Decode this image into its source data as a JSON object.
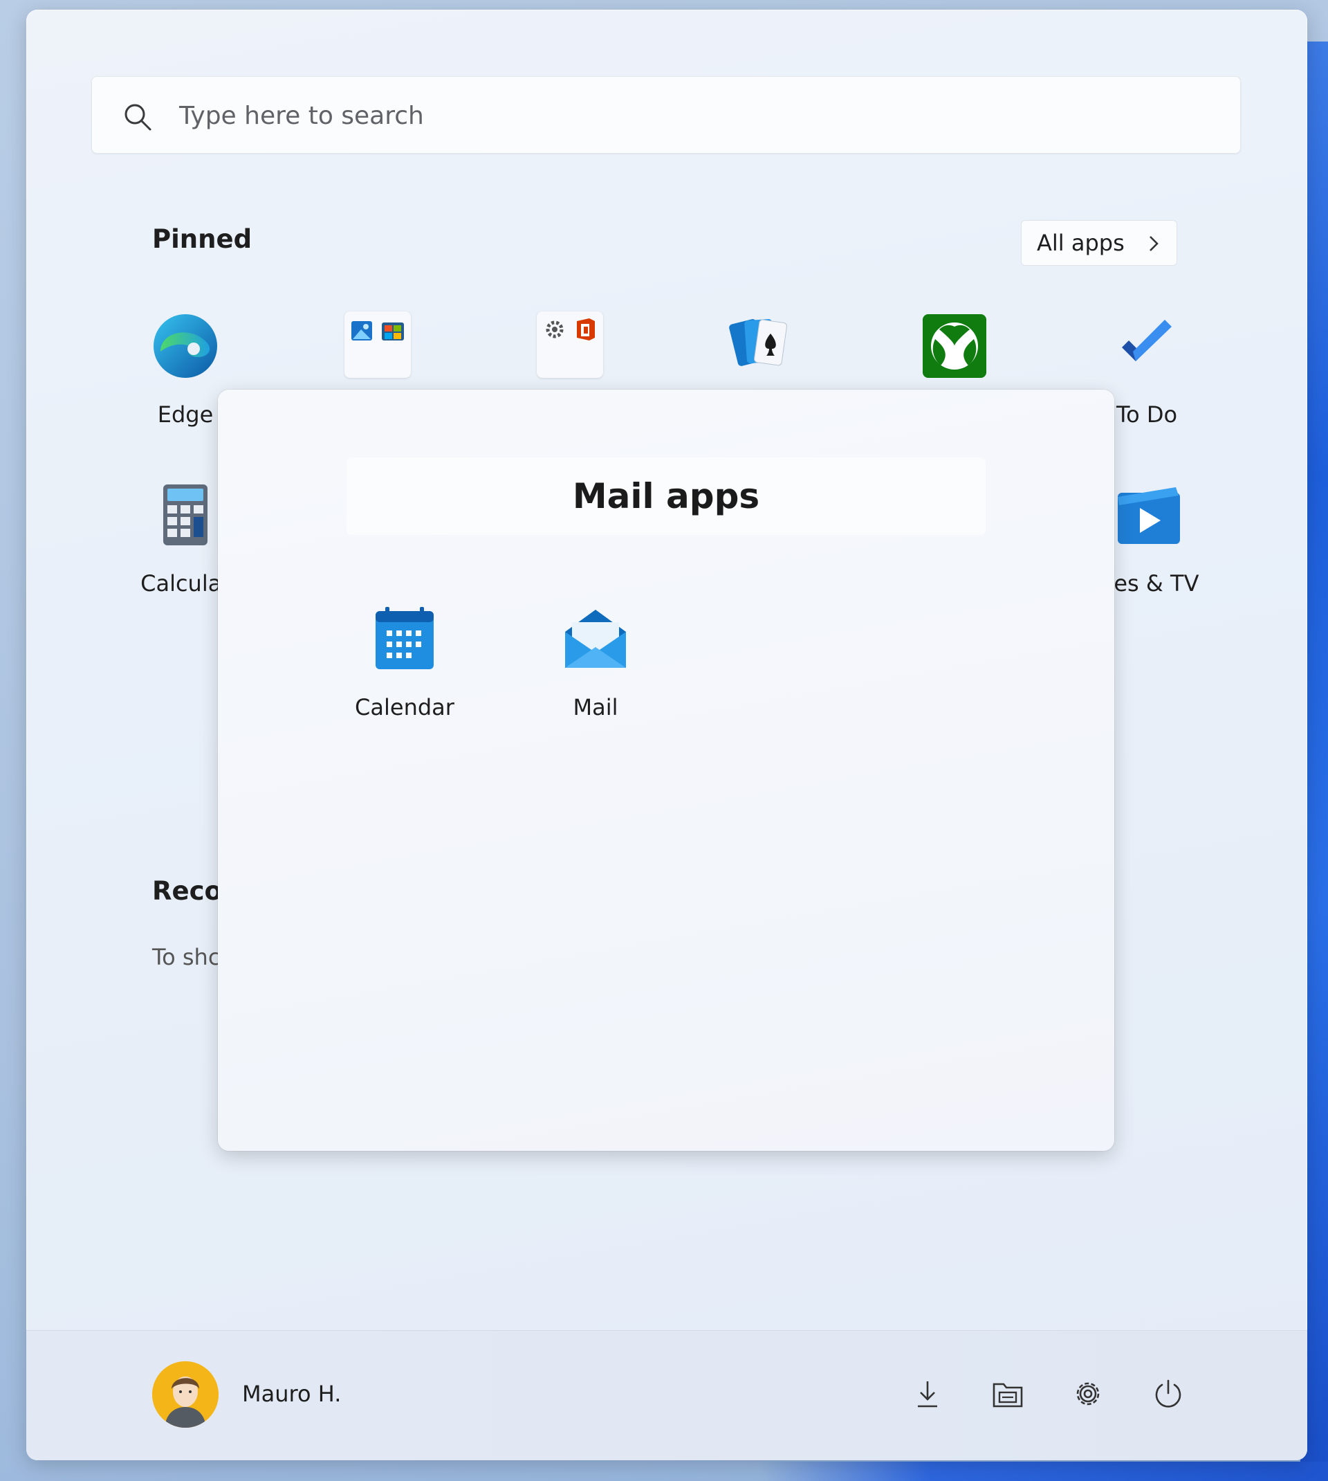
{
  "search": {
    "placeholder": "Type here to search"
  },
  "pinned": {
    "title": "Pinned",
    "all_apps_label": "All apps",
    "apps": [
      {
        "label": "Edge",
        "icon": "edge-icon"
      },
      {
        "label": "",
        "icon": "photos-store-folder-icon"
      },
      {
        "label": "",
        "icon": "settings-office-folder-icon"
      },
      {
        "label": "",
        "icon": "solitaire-icon"
      },
      {
        "label": "",
        "icon": "xbox-icon"
      },
      {
        "label": "To Do",
        "icon": "todo-icon"
      },
      {
        "label": "Calculat",
        "icon": "calculator-icon"
      },
      {
        "label": "vies & TV",
        "icon": "movies-tv-icon"
      }
    ]
  },
  "recommended": {
    "title": "Recor",
    "subtitle": "To shc"
  },
  "folder_popup": {
    "title": "Mail apps",
    "apps": [
      {
        "label": "Calendar",
        "icon": "calendar-icon"
      },
      {
        "label": "Mail",
        "icon": "mail-icon"
      }
    ]
  },
  "footer": {
    "user_name": "Mauro H.",
    "buttons": [
      "downloads-icon",
      "file-explorer-icon",
      "settings-icon",
      "power-icon"
    ]
  },
  "colors": {
    "accent": "#0f6cbd",
    "xbox_green": "#107c10",
    "menu_bg": "#eaf0f8"
  }
}
